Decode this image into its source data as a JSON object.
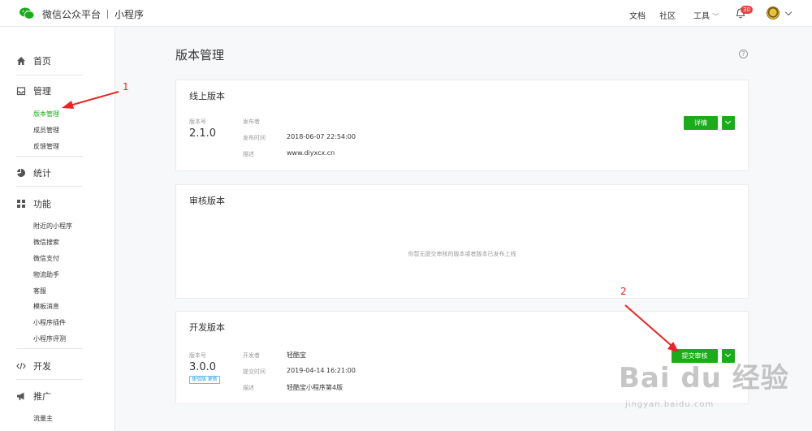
{
  "topbar": {
    "brand": "微信公众平台",
    "product": "小程序",
    "links": [
      "文档",
      "社区",
      "工具"
    ],
    "notification_count": "30"
  },
  "sidebar": {
    "sections": [
      {
        "label": "首页",
        "icon": "home-icon"
      },
      {
        "label": "管理",
        "icon": "inbox-icon",
        "items": [
          "版本管理",
          "成员管理",
          "反馈管理"
        ],
        "active": "版本管理"
      },
      {
        "label": "统计",
        "icon": "pie-chart-icon"
      },
      {
        "label": "功能",
        "icon": "grid-icon",
        "items": [
          "附近的小程序",
          "微信搜索",
          "微信支付",
          "物流助手",
          "客服",
          "模板消息",
          "小程序插件",
          "小程序评测"
        ]
      },
      {
        "label": "开发",
        "icon": "code-icon"
      },
      {
        "label": "推广",
        "icon": "megaphone-icon",
        "items": [
          "流量主"
        ]
      }
    ]
  },
  "main": {
    "title": "版本管理",
    "online": {
      "title": "线上版本",
      "version_label": "版本号",
      "version": "2.1.0",
      "publisher_label": "发布者",
      "publisher": "",
      "time_label": "发布时间",
      "time": "2018-06-07 22:54:00",
      "desc_label": "描述",
      "desc": "www.diyxcx.cn",
      "detail_button": "详情"
    },
    "review": {
      "title": "审核版本",
      "empty": "你暂无提交审核的版本或者版本已发布上线"
    },
    "dev": {
      "title": "开发版本",
      "version_label": "版本号",
      "version": "3.0.0",
      "tag": "体验版 更新",
      "developer_label": "开发者",
      "developer": "轻酷宝",
      "time_label": "提交时间",
      "time": "2019-04-14 16:21:00",
      "desc_label": "描述",
      "desc": "轻酷宝小程序第4版",
      "submit_button": "提交审核"
    }
  },
  "annotations": {
    "arrow1": "1",
    "arrow2": "2",
    "arrow_color": "#ee2222"
  },
  "watermark": {
    "logo": "Bai du 经验",
    "url": "jingyan.baidu.com"
  },
  "colors": {
    "accent": "#1aad19",
    "badge": "#e64340"
  }
}
